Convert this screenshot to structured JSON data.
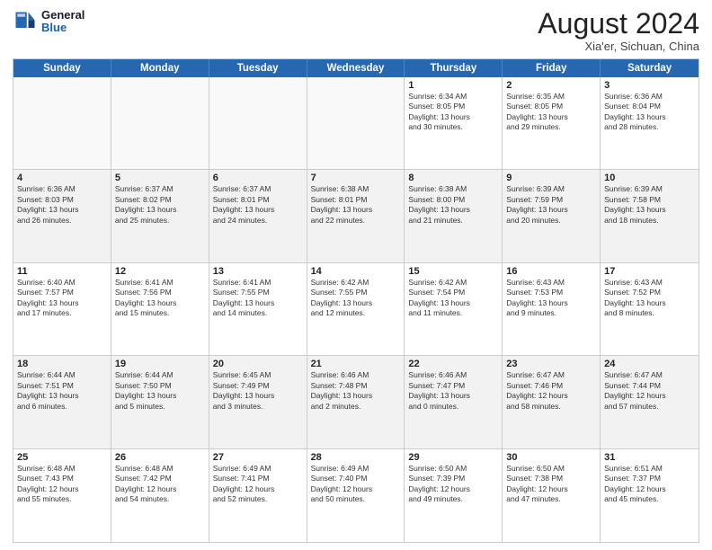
{
  "logo": {
    "line1": "General",
    "line2": "Blue"
  },
  "title": "August 2024",
  "subtitle": "Xia'er, Sichuan, China",
  "days": [
    "Sunday",
    "Monday",
    "Tuesday",
    "Wednesday",
    "Thursday",
    "Friday",
    "Saturday"
  ],
  "weeks": [
    [
      {
        "day": "",
        "text": ""
      },
      {
        "day": "",
        "text": ""
      },
      {
        "day": "",
        "text": ""
      },
      {
        "day": "",
        "text": ""
      },
      {
        "day": "1",
        "text": "Sunrise: 6:34 AM\nSunset: 8:05 PM\nDaylight: 13 hours\nand 30 minutes."
      },
      {
        "day": "2",
        "text": "Sunrise: 6:35 AM\nSunset: 8:05 PM\nDaylight: 13 hours\nand 29 minutes."
      },
      {
        "day": "3",
        "text": "Sunrise: 6:36 AM\nSunset: 8:04 PM\nDaylight: 13 hours\nand 28 minutes."
      }
    ],
    [
      {
        "day": "4",
        "text": "Sunrise: 6:36 AM\nSunset: 8:03 PM\nDaylight: 13 hours\nand 26 minutes."
      },
      {
        "day": "5",
        "text": "Sunrise: 6:37 AM\nSunset: 8:02 PM\nDaylight: 13 hours\nand 25 minutes."
      },
      {
        "day": "6",
        "text": "Sunrise: 6:37 AM\nSunset: 8:01 PM\nDaylight: 13 hours\nand 24 minutes."
      },
      {
        "day": "7",
        "text": "Sunrise: 6:38 AM\nSunset: 8:01 PM\nDaylight: 13 hours\nand 22 minutes."
      },
      {
        "day": "8",
        "text": "Sunrise: 6:38 AM\nSunset: 8:00 PM\nDaylight: 13 hours\nand 21 minutes."
      },
      {
        "day": "9",
        "text": "Sunrise: 6:39 AM\nSunset: 7:59 PM\nDaylight: 13 hours\nand 20 minutes."
      },
      {
        "day": "10",
        "text": "Sunrise: 6:39 AM\nSunset: 7:58 PM\nDaylight: 13 hours\nand 18 minutes."
      }
    ],
    [
      {
        "day": "11",
        "text": "Sunrise: 6:40 AM\nSunset: 7:57 PM\nDaylight: 13 hours\nand 17 minutes."
      },
      {
        "day": "12",
        "text": "Sunrise: 6:41 AM\nSunset: 7:56 PM\nDaylight: 13 hours\nand 15 minutes."
      },
      {
        "day": "13",
        "text": "Sunrise: 6:41 AM\nSunset: 7:55 PM\nDaylight: 13 hours\nand 14 minutes."
      },
      {
        "day": "14",
        "text": "Sunrise: 6:42 AM\nSunset: 7:55 PM\nDaylight: 13 hours\nand 12 minutes."
      },
      {
        "day": "15",
        "text": "Sunrise: 6:42 AM\nSunset: 7:54 PM\nDaylight: 13 hours\nand 11 minutes."
      },
      {
        "day": "16",
        "text": "Sunrise: 6:43 AM\nSunset: 7:53 PM\nDaylight: 13 hours\nand 9 minutes."
      },
      {
        "day": "17",
        "text": "Sunrise: 6:43 AM\nSunset: 7:52 PM\nDaylight: 13 hours\nand 8 minutes."
      }
    ],
    [
      {
        "day": "18",
        "text": "Sunrise: 6:44 AM\nSunset: 7:51 PM\nDaylight: 13 hours\nand 6 minutes."
      },
      {
        "day": "19",
        "text": "Sunrise: 6:44 AM\nSunset: 7:50 PM\nDaylight: 13 hours\nand 5 minutes."
      },
      {
        "day": "20",
        "text": "Sunrise: 6:45 AM\nSunset: 7:49 PM\nDaylight: 13 hours\nand 3 minutes."
      },
      {
        "day": "21",
        "text": "Sunrise: 6:46 AM\nSunset: 7:48 PM\nDaylight: 13 hours\nand 2 minutes."
      },
      {
        "day": "22",
        "text": "Sunrise: 6:46 AM\nSunset: 7:47 PM\nDaylight: 13 hours\nand 0 minutes."
      },
      {
        "day": "23",
        "text": "Sunrise: 6:47 AM\nSunset: 7:46 PM\nDaylight: 12 hours\nand 58 minutes."
      },
      {
        "day": "24",
        "text": "Sunrise: 6:47 AM\nSunset: 7:44 PM\nDaylight: 12 hours\nand 57 minutes."
      }
    ],
    [
      {
        "day": "25",
        "text": "Sunrise: 6:48 AM\nSunset: 7:43 PM\nDaylight: 12 hours\nand 55 minutes."
      },
      {
        "day": "26",
        "text": "Sunrise: 6:48 AM\nSunset: 7:42 PM\nDaylight: 12 hours\nand 54 minutes."
      },
      {
        "day": "27",
        "text": "Sunrise: 6:49 AM\nSunset: 7:41 PM\nDaylight: 12 hours\nand 52 minutes."
      },
      {
        "day": "28",
        "text": "Sunrise: 6:49 AM\nSunset: 7:40 PM\nDaylight: 12 hours\nand 50 minutes."
      },
      {
        "day": "29",
        "text": "Sunrise: 6:50 AM\nSunset: 7:39 PM\nDaylight: 12 hours\nand 49 minutes."
      },
      {
        "day": "30",
        "text": "Sunrise: 6:50 AM\nSunset: 7:38 PM\nDaylight: 12 hours\nand 47 minutes."
      },
      {
        "day": "31",
        "text": "Sunrise: 6:51 AM\nSunset: 7:37 PM\nDaylight: 12 hours\nand 45 minutes."
      }
    ]
  ]
}
